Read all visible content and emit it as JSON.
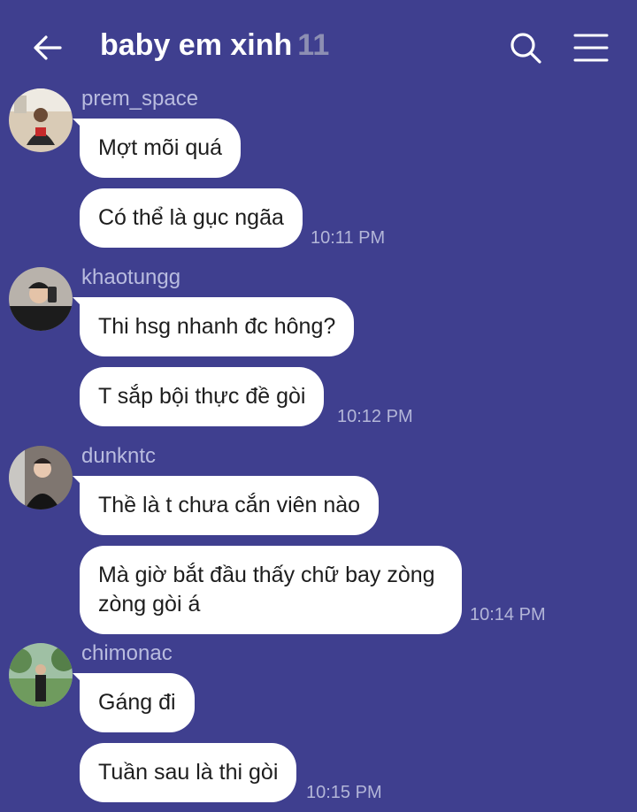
{
  "header": {
    "title": "baby em xinh",
    "member_count": "11",
    "back_icon": "arrow-left-icon",
    "search_icon": "search-icon",
    "menu_icon": "hamburger-menu-icon"
  },
  "messages": [
    {
      "sender": "prem_space",
      "avatar": "avatar-prem-space",
      "bubbles": [
        "Mợt mõi quá",
        "Có thể là gục ngãa"
      ],
      "time": "10:11 PM"
    },
    {
      "sender": "khaotungg",
      "avatar": "avatar-khaotungg",
      "bubbles": [
        "Thi hsg nhanh đc hông?",
        "T sắp bội thực đề gòi"
      ],
      "time": "10:12 PM"
    },
    {
      "sender": "dunkntc",
      "avatar": "avatar-dunkntc",
      "bubbles": [
        "Thề là t chưa cắn viên nào",
        "Mà giờ bắt đầu thấy chữ bay zòng zòng gòi á"
      ],
      "time": "10:14 PM"
    },
    {
      "sender": "chimonac",
      "avatar": "avatar-chimonac",
      "bubbles": [
        "Gáng đi",
        "Tuần sau là thi gòi"
      ],
      "time": "10:15 PM"
    }
  ],
  "colors": {
    "background": "#3f3f8f",
    "bubble": "#ffffff",
    "sender_name": "#b9bcdf",
    "timestamp": "#b3b6d8",
    "member_count": "#8d8fb3"
  }
}
